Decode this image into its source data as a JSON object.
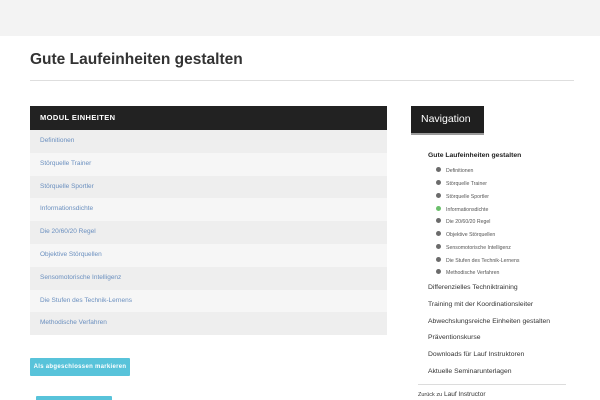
{
  "page": {
    "title": "Gute Laufeinheiten gestalten"
  },
  "module": {
    "header": "MODUL EINHEITEN",
    "items": [
      "Definitionen",
      "Störquelle Trainer",
      "Störquelle Sportler",
      "Informationsdichte",
      "Die 20/60/20 Regel",
      "Objektive Störquellen",
      "Sensomotorische Intelligenz",
      "Die Stufen des Technik-Lernens",
      "Methodische Verfahren"
    ],
    "complete_button": "Als abgeschlossen markieren"
  },
  "navigation": {
    "title": "Navigation",
    "current": "Gute Laufeinheiten gestalten",
    "sub_items": [
      "Definitionen",
      "Störquelle Trainer",
      "Störquelle Sportler",
      "Informationsdichte",
      "Die 20/60/20 Regel",
      "Objektive Störquellen",
      "Sensomotorische Intelligenz",
      "Die Stufen des Technik-Lernens",
      "Methodische Verfahren"
    ],
    "active_sub_index": 3,
    "links": [
      "Differenzielles Techniktraining",
      "Training mit der Koordinationsleiter",
      "Abwechslungsreiche Einheiten gestalten",
      "Präventionskurse",
      "Downloads für Lauf Instruktoren",
      "Aktuelle Seminarunterlagen"
    ],
    "back_prefix": "Zurück zu",
    "back_target": "Lauf Instructor"
  },
  "colors": {
    "header_bg": "#222222",
    "link_blue": "#6a8fbf",
    "button_cyan": "#58c3da",
    "active_dot": "#6bbf6b"
  }
}
